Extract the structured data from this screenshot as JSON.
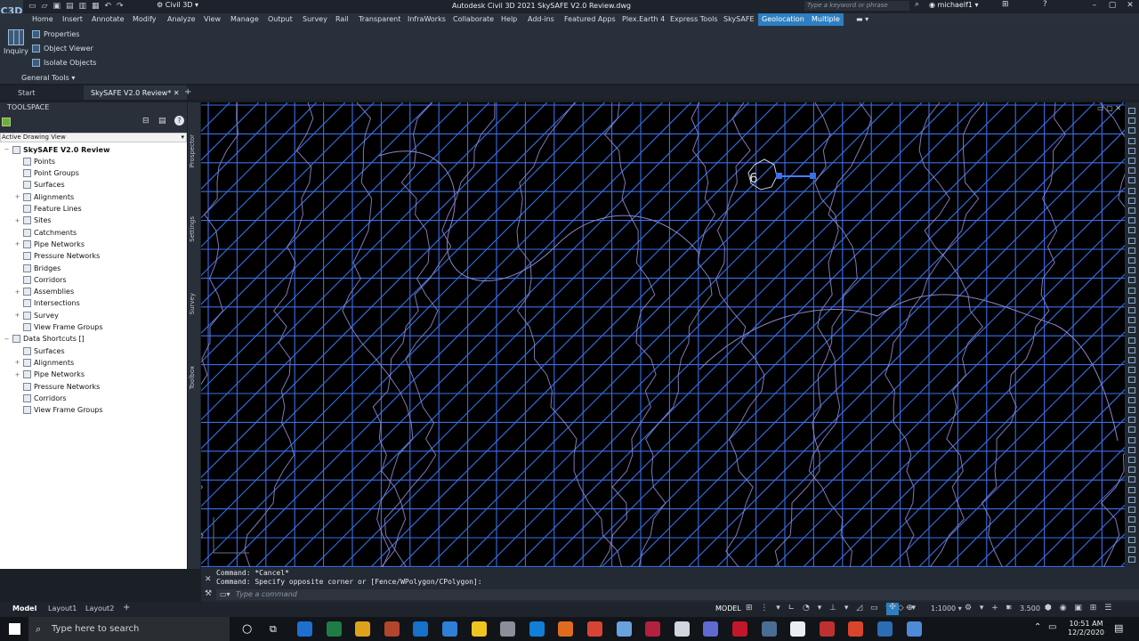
{
  "titlebar": {
    "app_logo": "C3D",
    "workspace": "Civil 3D",
    "title": "Autodesk Civil 3D 2021   SkySAFE V2.0 Review.dwg",
    "search_placeholder": "Type a keyword or phrase",
    "user": "michaelf1"
  },
  "menubar": {
    "tabs": [
      "Home",
      "Insert",
      "Annotate",
      "Modify",
      "Analyze",
      "View",
      "Manage",
      "Output",
      "Survey",
      "Rail",
      "Transparent",
      "InfraWorks",
      "Collaborate",
      "Help",
      "Add-ins",
      "Featured Apps",
      "Plex.Earth 4",
      "Express Tools",
      "SkySAFE",
      "Geolocation",
      "Multiple"
    ]
  },
  "ribbon": {
    "inquiry": "Inquiry",
    "properties": "Properties",
    "object_viewer": "Object Viewer",
    "isolate_objects": "Isolate Objects",
    "general_tools": "General Tools ▾"
  },
  "doc_tabs": {
    "start": "Start",
    "drawing": "SkySAFE V2.0 Review*"
  },
  "toolspace": {
    "header": "TOOLSPACE",
    "view": "Active Drawing View",
    "tree": [
      {
        "label": "SkySAFE V2.0 Review",
        "level": 0,
        "bold": true,
        "exp": "−"
      },
      {
        "label": "Points",
        "level": 1,
        "exp": ""
      },
      {
        "label": "Point Groups",
        "level": 1,
        "exp": ""
      },
      {
        "label": "Surfaces",
        "level": 1,
        "exp": ""
      },
      {
        "label": "Alignments",
        "level": 1,
        "exp": "+"
      },
      {
        "label": "Feature Lines",
        "level": 1,
        "exp": ""
      },
      {
        "label": "Sites",
        "level": 1,
        "exp": "+"
      },
      {
        "label": "Catchments",
        "level": 1,
        "exp": ""
      },
      {
        "label": "Pipe Networks",
        "level": 1,
        "exp": "+"
      },
      {
        "label": "Pressure Networks",
        "level": 1,
        "exp": ""
      },
      {
        "label": "Bridges",
        "level": 1,
        "exp": ""
      },
      {
        "label": "Corridors",
        "level": 1,
        "exp": ""
      },
      {
        "label": "Assemblies",
        "level": 1,
        "exp": "+"
      },
      {
        "label": "Intersections",
        "level": 1,
        "exp": ""
      },
      {
        "label": "Survey",
        "level": 1,
        "exp": "+"
      },
      {
        "label": "View Frame Groups",
        "level": 1,
        "exp": ""
      },
      {
        "label": "Data Shortcuts []",
        "level": 0,
        "bold": false,
        "exp": "−"
      },
      {
        "label": "Surfaces",
        "level": 1,
        "exp": ""
      },
      {
        "label": "Alignments",
        "level": 1,
        "exp": "+"
      },
      {
        "label": "Pipe Networks",
        "level": 1,
        "exp": "+"
      },
      {
        "label": "Pressure Networks",
        "level": 1,
        "exp": ""
      },
      {
        "label": "Corridors",
        "level": 1,
        "exp": ""
      },
      {
        "label": "View Frame Groups",
        "level": 1,
        "exp": ""
      }
    ],
    "vtabs": [
      "Prospector",
      "Settings",
      "Survey",
      "Toolbox"
    ]
  },
  "canvas": {
    "marker_label": "6"
  },
  "command": {
    "line1": "Command: *Cancel*",
    "line2": "Command: Specify opposite corner or [Fence/WPolygon/CPolygon]:",
    "placeholder": "Type a command"
  },
  "status": {
    "layouts": [
      "Model",
      "Layout1",
      "Layout2"
    ],
    "model_label": "MODEL",
    "scale": "1:1000",
    "anno_value": "3.500"
  },
  "taskbar": {
    "search_placeholder": "Type here to search",
    "time": "10:51 AM",
    "date": "12/2/2020"
  },
  "colors": {
    "accent": "#2d7fc1",
    "grid": "#3a6fe8",
    "contour": "#8e84c8"
  }
}
